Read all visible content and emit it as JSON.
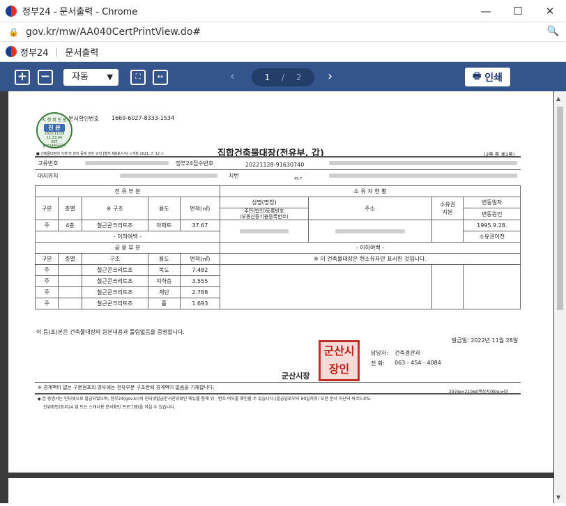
{
  "window": {
    "title": "정부24 - 문서출력 - Chrome",
    "minimize": "—",
    "maximize": "☐",
    "close": "✕"
  },
  "address": {
    "url": "gov.kr/mw/AA040CertPrintView.do#"
  },
  "site": {
    "name": "정부24",
    "page": "문서출력"
  },
  "toolbar": {
    "zoom_in": "+",
    "zoom_out": "−",
    "zoom_select": "자동",
    "fit_page": "⛶",
    "fit_width": "↔",
    "current_page": "1",
    "page_sep": "/",
    "total_pages": "2",
    "prev": "‹",
    "next": "›",
    "print_label": "인쇄"
  },
  "doc": {
    "confirm_label": "문서확인번호",
    "confirm_no": "1669-6027-8333-1534",
    "stamp": {
      "top": "시 청 확 인 원",
      "main": "진 본",
      "date": "2022/11/28",
      "time": "11:33:04",
      "kst": "KST",
      "bottom": "정부24발급문서"
    },
    "rule_note": "■ 건축물대장의 기재 및 관리 등에 관한 규칙 [별지 제6호서식] <개정 2021. 7. 12.>",
    "title": "집합건축물대장(전유부, 갑)",
    "pages_note": "(2쪽 중 제1쪽)",
    "h_unique": "고유번호",
    "h_receipt": "정부24접수번호",
    "receipt_no": "20221128-91630740",
    "h_site": "대지위치",
    "h_lot": "지번",
    "lot_sub": "45-7",
    "sec_private": "전 유 부 분",
    "sec_owner": "소 유 자 현 황",
    "h_div": "구분",
    "h_floor": "층별",
    "h_struct_star": "※ 구조",
    "h_use": "용도",
    "h_area": "면적(㎡)",
    "h_name": "성명(명칭)",
    "h_id": "주민(법인)등록번호",
    "h_id2": "(부동산등기용등록번호)",
    "h_addr": "주소",
    "h_share": "소유권",
    "h_share2": "지분",
    "h_date": "변동일자",
    "h_reason": "변동원인",
    "p_div": "주",
    "p_floor": "4층",
    "p_struct": "철근콘크리트조",
    "p_use": "아파트",
    "p_area": "37.67",
    "p_date": "1995.9.28.",
    "p_reason": "소유권이전",
    "blank1": "- 이하여백 -",
    "sec_common": "공 용 부 분",
    "h_struct": "구조",
    "blank2": "- 이하여백 -",
    "common_note": "※ 이 건축물대장은 현소유자만 표시한 것입니다.",
    "rows": [
      {
        "div": "주",
        "floor": "",
        "struct": "철근콘크리트조",
        "use": "복도",
        "area": "7.482"
      },
      {
        "div": "주",
        "floor": "",
        "struct": "철근콘크리트조",
        "use": "지하층",
        "area": "3.555"
      },
      {
        "div": "주",
        "floor": "",
        "struct": "철근콘크리트조",
        "use": "계단",
        "area": "2.788"
      },
      {
        "div": "주",
        "floor": "",
        "struct": "철근콘크리트조",
        "use": "홀",
        "area": "1.693"
      }
    ],
    "certify": "이 등(초)본은 건축물대장의 원본내용과 틀림없음을 증명합니다.",
    "issue_date": "발급일: 2022년 11월 28일",
    "officer_label": "담당자:",
    "officer": "건축경관과",
    "phone_label": "전  화:",
    "phone": "063 - 454 - 4084",
    "issuer": "군산시장",
    "seal": "군산시장인",
    "foot1": "※ 경계벽이 없는 구분점포의 경우에는 전유부분 구조란에 경계벽이 없음을 기재합니다.",
    "paper": "297㎜×210㎜[백상지(80g/㎡)]",
    "foot2": "◆ 본 증명서는 인터넷으로 발급되었으며, 정부24(gov.kr)의 인터넷발급문서진위확인 메뉴를 통해 위 · 변조 여부를 확인할 수 있습니다.(발급일로부터 90일까지) 또한 문서 하단의 바코드로도",
    "foot3": "진위확인(정부24 앱 또는 스캐너용 문서확인 프로그램)을 하실 수 있습니다."
  }
}
